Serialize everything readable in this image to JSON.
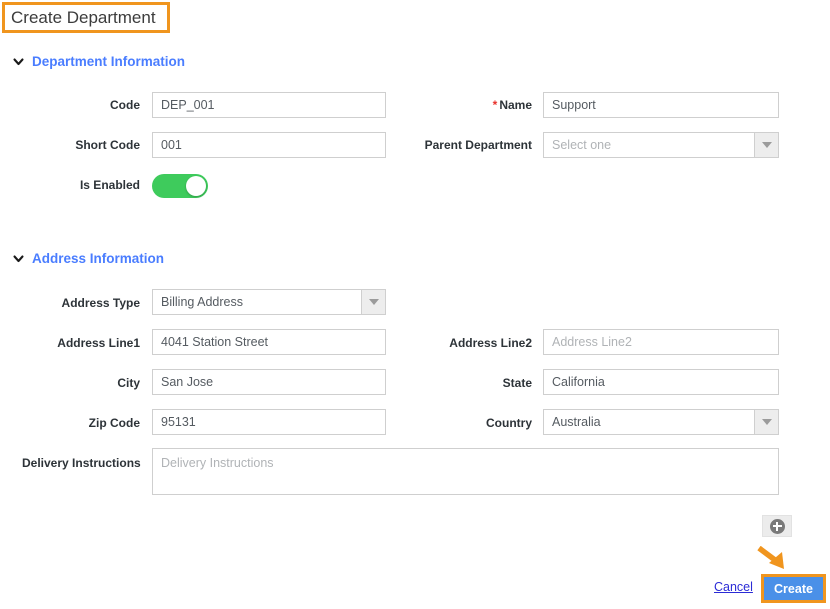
{
  "page": {
    "title": "Create Department"
  },
  "sections": [
    {
      "title": "Department Information",
      "chevron_icon": "chevron-down-icon"
    },
    {
      "title": "Address Information",
      "chevron_icon": "chevron-down-icon"
    }
  ],
  "department_information": {
    "code": {
      "label": "Code",
      "value": "DEP_001"
    },
    "name": {
      "label": "Name",
      "required_marker": "*",
      "value": "Support"
    },
    "short_code": {
      "label": "Short Code",
      "value": "001"
    },
    "parent_department": {
      "label": "Parent Department",
      "value": "Select one",
      "is_placeholder": true
    },
    "is_enabled": {
      "label": "Is Enabled",
      "state": "on"
    }
  },
  "address_information": {
    "address_type": {
      "label": "Address Type",
      "value": "Billing Address"
    },
    "address_line1": {
      "label": "Address Line1",
      "value": "4041 Station Street"
    },
    "address_line2": {
      "label": "Address Line2",
      "value": "",
      "placeholder": "Address Line2"
    },
    "city": {
      "label": "City",
      "value": "San Jose"
    },
    "state": {
      "label": "State",
      "value": "California"
    },
    "zip_code": {
      "label": "Zip Code",
      "value": "95131"
    },
    "country": {
      "label": "Country",
      "value": "Australia"
    },
    "delivery_instructions": {
      "label": "Delivery Instructions",
      "value": "",
      "placeholder": "Delivery Instructions"
    }
  },
  "actions": {
    "add_button_icon": "plus-circle-icon",
    "cancel_label": "Cancel",
    "create_label": "Create"
  },
  "colors": {
    "section_title": "#4a7dff",
    "highlight_border": "#f0951e",
    "toggle_on": "#3ecb5c",
    "primary_button": "#4a90e8",
    "required_star": "#e8322c",
    "link": "#2b2bd6"
  }
}
